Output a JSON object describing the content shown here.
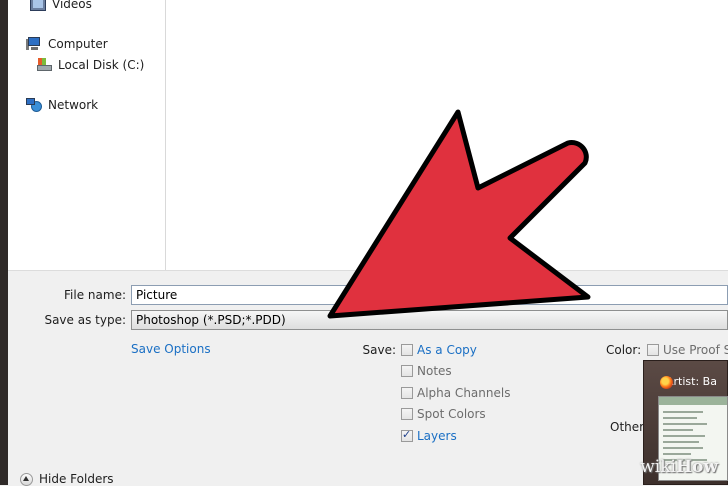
{
  "tree": {
    "items": [
      {
        "label": "Videos",
        "icon": "videos-icon"
      },
      {
        "label": "Computer",
        "icon": "computer-icon"
      },
      {
        "label": "Local Disk (C:)",
        "icon": "local-disk-icon"
      },
      {
        "label": "Network",
        "icon": "network-icon"
      }
    ]
  },
  "form": {
    "file_name_label": "File name:",
    "file_name_value": "Picture",
    "save_type_label": "Save as type:",
    "save_type_value": "Photoshop (*.PSD;*.PDD)",
    "save_options_link": "Save Options",
    "save_label": "Save:",
    "options": [
      {
        "label": "As a Copy",
        "checked": false,
        "enabled": true
      },
      {
        "label": "Notes",
        "checked": false,
        "enabled": false
      },
      {
        "label": "Alpha Channels",
        "checked": false,
        "enabled": false
      },
      {
        "label": "Spot Colors",
        "checked": false,
        "enabled": false
      },
      {
        "label": "Layers",
        "checked": true,
        "enabled": true
      }
    ],
    "color_label": "Color:",
    "use_proof_label": "Use Proof Se",
    "other_label": "Other:",
    "hide_folders": "Hide Folders"
  },
  "taskbar_preview": {
    "title": "Artist: Ba"
  },
  "watermark": {
    "part1": "wiki",
    "part2": "How"
  },
  "colors": {
    "arrow": "#e0313e",
    "link": "#1a6fc4",
    "frame": "#2f2a28"
  }
}
